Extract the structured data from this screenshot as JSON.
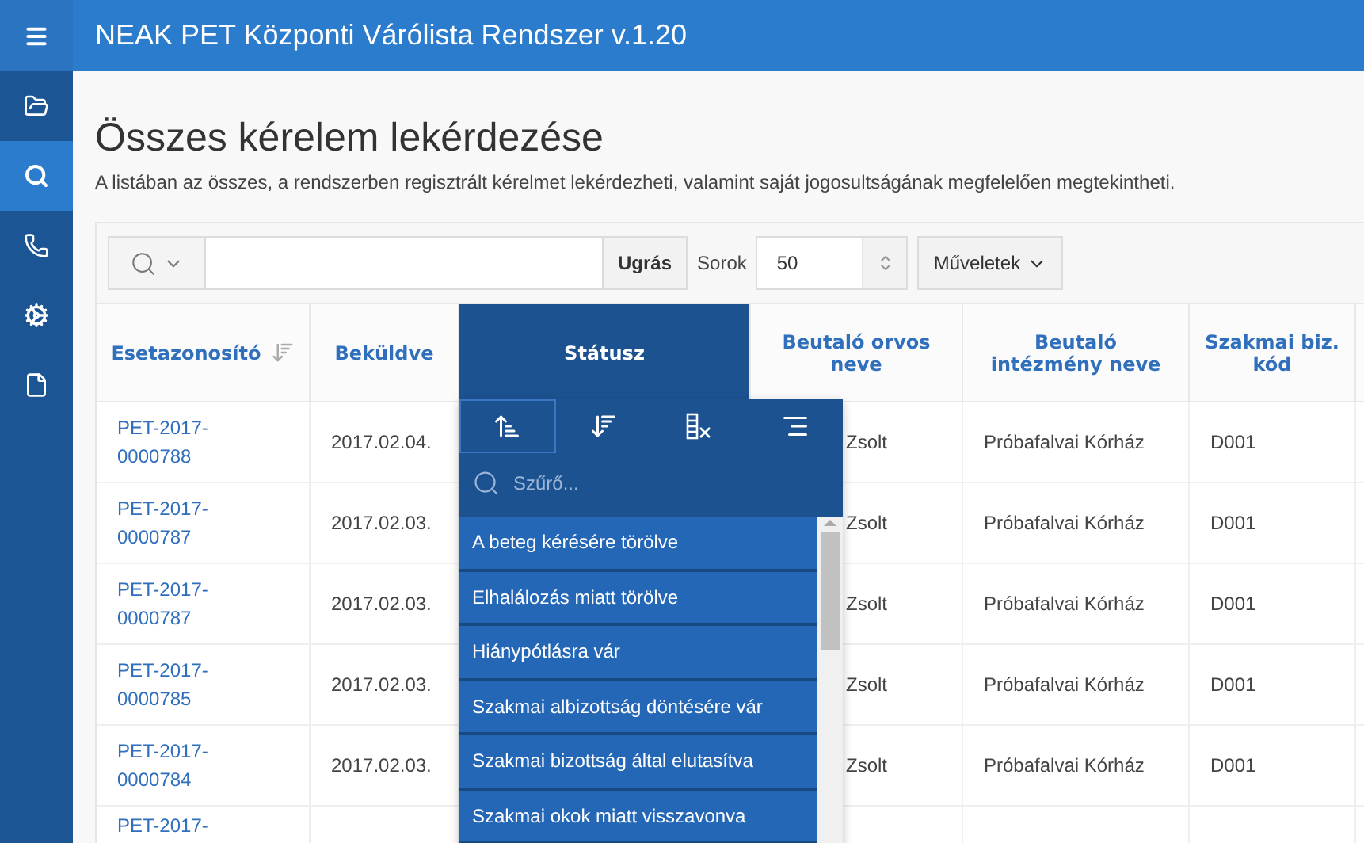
{
  "app": {
    "title": "NEAK PET Központi Várólista Rendszer v.1.20"
  },
  "nav": [
    {
      "kind": "folder",
      "selected": false
    },
    {
      "kind": "search",
      "selected": true
    },
    {
      "kind": "phone",
      "selected": false
    },
    {
      "kind": "gears",
      "selected": false
    },
    {
      "kind": "file",
      "selected": false
    }
  ],
  "page": {
    "title": "Összes kérelem lekérdezése",
    "description": "A listában az összes, a rendszerben regisztrált kérelmet lekérdezheti, valamint saját jogosultságának megfelelően megtekintheti."
  },
  "toolbar": {
    "go_button": "Ugrás",
    "rows_label": "Sorok",
    "rows_value": "50",
    "actions_button": "Műveletek"
  },
  "table": {
    "columns": [
      {
        "label": "Esetazonosító",
        "sorted": true,
        "selected": false
      },
      {
        "label": "Beküldve",
        "sorted": false,
        "selected": false
      },
      {
        "label": "Státusz",
        "sorted": false,
        "selected": true
      },
      {
        "label": "Beutaló orvos neve",
        "sorted": false,
        "selected": false
      },
      {
        "label": "Beutaló intézmény neve",
        "sorted": false,
        "selected": false
      },
      {
        "label": "Szakmai biz. kód",
        "sorted": false,
        "selected": false
      }
    ],
    "rows": [
      {
        "id": "PET-2017-0000788",
        "submitted": "2017.02.04.",
        "doctor": "Zsolt",
        "institution": "Próbafalvai Kórház",
        "code": "D001"
      },
      {
        "id": "PET-2017-0000787",
        "submitted": "2017.02.03.",
        "doctor": "Zsolt",
        "institution": "Próbafalvai Kórház",
        "code": "D001"
      },
      {
        "id": "PET-2017-0000787",
        "submitted": "2017.02.03.",
        "doctor": "Zsolt",
        "institution": "Próbafalvai Kórház",
        "code": "D001"
      },
      {
        "id": "PET-2017-0000785",
        "submitted": "2017.02.03.",
        "doctor": "Zsolt",
        "institution": "Próbafalvai Kórház",
        "code": "D001"
      },
      {
        "id": "PET-2017-0000784",
        "submitted": "2017.02.03.",
        "doctor": "Zsolt",
        "institution": "Próbafalvai Kórház",
        "code": "D001"
      },
      {
        "id": "PET-2017-"
      }
    ]
  },
  "column_menu": {
    "actions": [
      {
        "kind": "sort-ascending",
        "selected": true
      },
      {
        "kind": "sort-descending",
        "selected": false
      },
      {
        "kind": "hide-column",
        "selected": false
      },
      {
        "kind": "control-break",
        "selected": false
      }
    ],
    "filter": {
      "placeholder": "Szűrő..."
    },
    "options": [
      "A beteg kérésére törölve",
      "Elhalálozás miatt törölve",
      "Hiánypótlásra vár",
      "Szakmai albizottság döntésére vár",
      "Szakmai bizottság által elutasítva",
      "Szakmai okok miatt visszavonva"
    ]
  }
}
